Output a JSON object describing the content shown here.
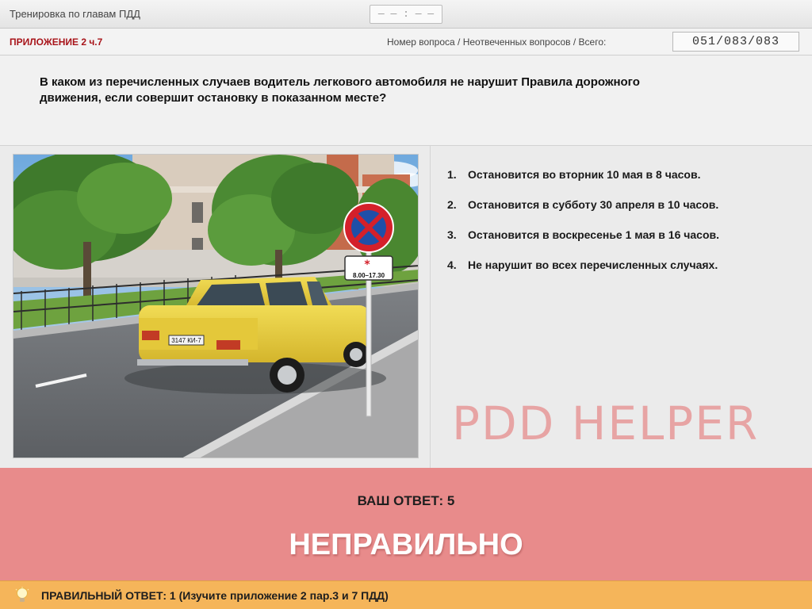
{
  "header": {
    "mode_title": "Тренировка по главам ПДД",
    "timer": "— — : — —"
  },
  "info": {
    "section": "ПРИЛОЖЕНИЕ 2 ч.7",
    "question_counter_label": "Номер вопроса / Неотвеченных вопросов / Всего:",
    "question_counter": "051/083/083"
  },
  "question": {
    "text": "В каком из перечисленных случаев водитель легкового автомобиля не нарушит Правила дорожного движения, если совершит остановку в показанном месте?"
  },
  "image": {
    "plate_text": "3147 КИ-7",
    "sign_time_start": "8.00",
    "sign_time_end": "17.30",
    "sign_time_sep": "–"
  },
  "answers": [
    {
      "num": "1.",
      "text": "Остановится во вторник 10 мая в 8 часов."
    },
    {
      "num": "2.",
      "text": "Остановится в субботу 30 апреля в 10 часов."
    },
    {
      "num": "3.",
      "text": "Остановится в воскресенье 1 мая в 16 часов."
    },
    {
      "num": "4.",
      "text": "Не нарушит во всех перечисленных случаях."
    }
  ],
  "watermark": "PDD HELPER",
  "result": {
    "your_answer": "ВАШ  ОТВЕТ:   5",
    "verdict": "НЕПРАВИЛЬНО"
  },
  "correct": {
    "text": "ПРАВИЛЬНЫЙ ОТВЕТ:   1   (Изучите приложение 2 пар.3 и 7 ПДД)"
  },
  "colors": {
    "section_red": "#a8141a",
    "result_bg": "#e88b8b",
    "correct_bg": "#f5b55a",
    "car_yellow": "#e8cf3e",
    "sign_red": "#d4202a",
    "sign_blue": "#1f4fa8"
  }
}
